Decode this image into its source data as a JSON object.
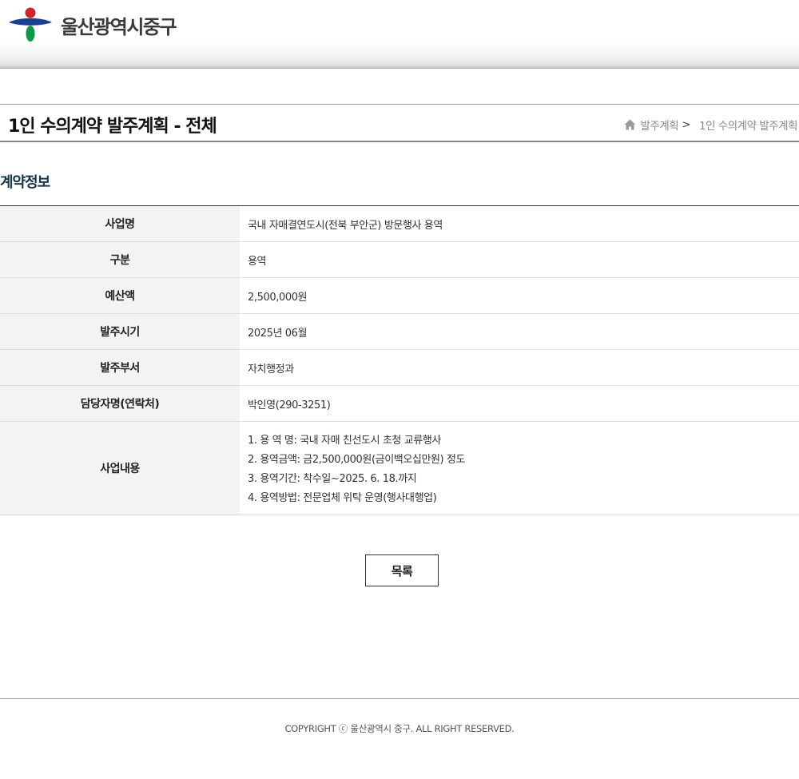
{
  "header": {
    "logo_text": "울산광역시중구",
    "brand_colors": {
      "red": "#d2232a",
      "blue": "#1c3f94",
      "green": "#0d9a48"
    }
  },
  "title_bar": {
    "page_title": "1인 수의계약 발주계획 - 전체",
    "breadcrumb": [
      {
        "label": "발주계획"
      },
      {
        "label": "1인 수의계약 발주계획"
      }
    ],
    "breadcrumb_separator": ">"
  },
  "section": {
    "title": "계약정보"
  },
  "table": {
    "rows": [
      {
        "label": "사업명",
        "value": "국내 자매결연도시(전북 부안군) 방문행사 용역"
      },
      {
        "label": "구분",
        "value": "용역"
      },
      {
        "label": "예산액",
        "value": "2,500,000원"
      },
      {
        "label": "발주시기",
        "value": "2025년 06월"
      },
      {
        "label": "발주부서",
        "value": "자치행정과"
      },
      {
        "label": "담당자명(연락처)",
        "value": "박인영(290-3251)"
      }
    ],
    "content": {
      "label": "사업내용",
      "lines": [
        "1. 용 역 명: 국내 자매 친선도시 초청 교류행사",
        "2. 용역금액: 금2,500,000원(금이백오십만원) 정도",
        "3. 용역기간: 착수일~2025. 6. 18.까지",
        "4. 용역방법: 전문업체 위탁 운영(행사대행업)"
      ]
    }
  },
  "actions": {
    "list_label": "목록"
  },
  "footer": {
    "copyright": "COPYRIGHT ⓒ 울산광역시 중구. ALL RIGHT RESERVED."
  }
}
